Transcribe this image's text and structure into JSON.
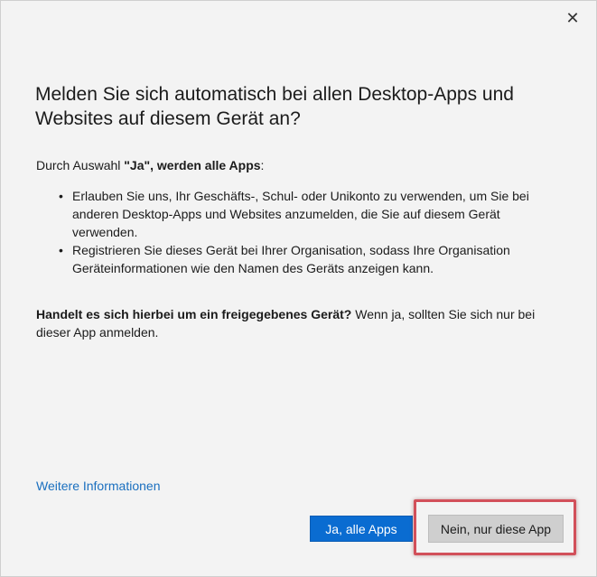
{
  "dialog": {
    "close_glyph": "✕",
    "title": "Melden Sie sich automatisch bei allen Desktop-Apps und Websites auf diesem Gerät an?",
    "intro_prefix": "Durch Auswahl ",
    "intro_bold": "\"Ja\", werden alle Apps",
    "intro_suffix": ":",
    "bullets": [
      "Erlauben Sie uns, Ihr Geschäfts-, Schul- oder Unikonto zu verwenden, um Sie bei anderen Desktop-Apps und Websites anzumelden, die Sie auf diesem Gerät verwenden.",
      "Registrieren Sie dieses Gerät bei Ihrer Organisation, sodass Ihre Organisation Geräteinformationen wie den Namen des Geräts anzeigen kann."
    ],
    "question_bold": "Handelt es sich hierbei um ein freigegebenes Gerät?",
    "question_rest": " Wenn ja, sollten Sie sich nur bei dieser App anmelden.",
    "more_info_link": "Weitere Informationen",
    "yes_button": "Ja, alle Apps",
    "no_button": "Nein, nur diese App"
  },
  "colors": {
    "background": "#f3f3f3",
    "primary_button": "#0a6cd1",
    "link": "#1a6fbf",
    "highlight_border": "#d2505a"
  },
  "icons": {
    "close": "close-icon",
    "bullet": "bullet-dot"
  }
}
